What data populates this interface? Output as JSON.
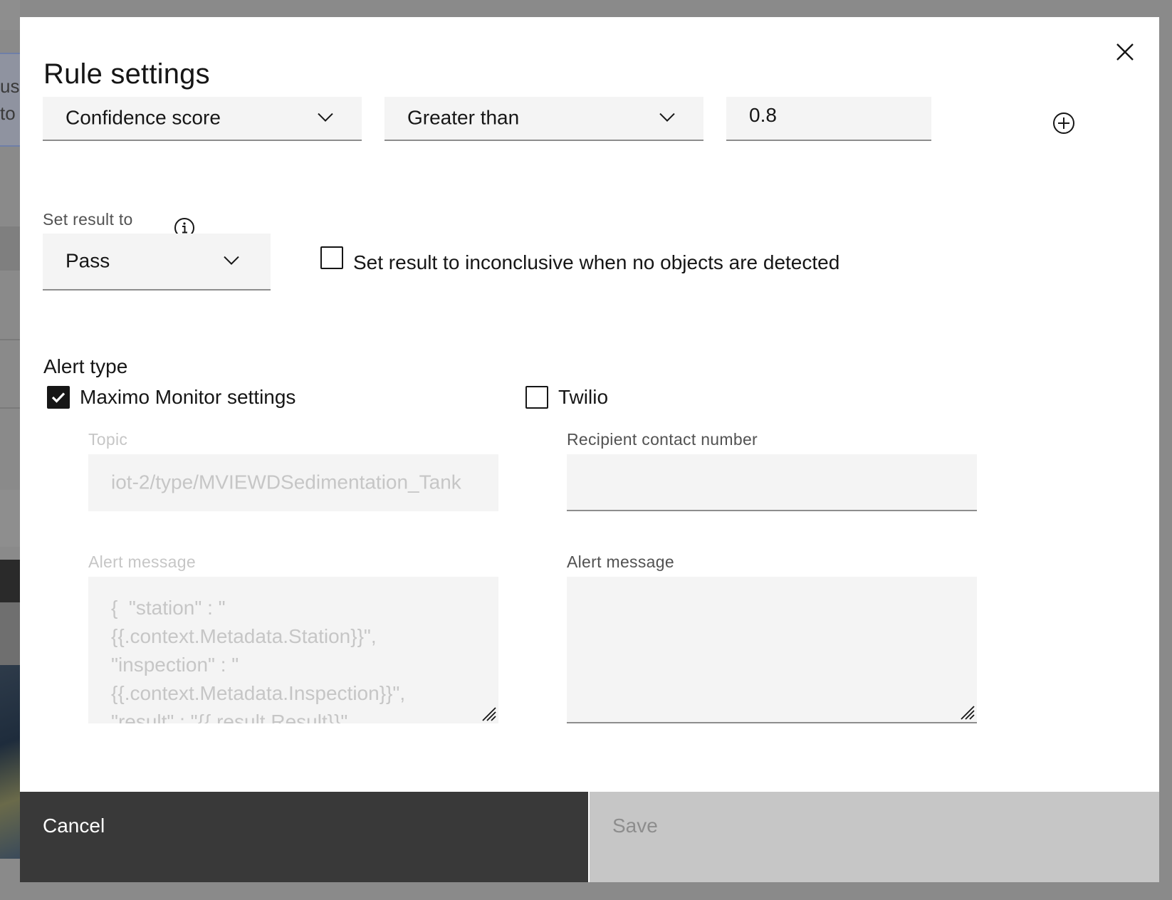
{
  "modal": {
    "title": "Rule settings"
  },
  "condition": {
    "property": "Confidence score",
    "operator": "Greater than",
    "value": "0.8"
  },
  "result": {
    "label": "Set result to",
    "selected": "Pass",
    "inconclusive_checkbox_label": "Set result to inconclusive when no objects are detected",
    "inconclusive_checked": false
  },
  "alert_type": {
    "title": "Alert type",
    "maximo": {
      "label": "Maximo Monitor settings",
      "checked": true,
      "topic_label": "Topic",
      "topic_value": "iot-2/type/MVIEWDSedimentation_Tank",
      "message_label": "Alert message",
      "message_value": "{  \"station\" : \"{{.context.Metadata.Station}}\", \"inspection\" : \"{{.context.Metadata.Inspection}}\", \"result\" : \"{{.result.Result}}\""
    },
    "twilio": {
      "label": "Twilio",
      "checked": false,
      "recipient_label": "Recipient contact number",
      "recipient_value": "",
      "message_label": "Alert message",
      "message_value": ""
    }
  },
  "footer": {
    "cancel_label": "Cancel",
    "save_label": "Save"
  },
  "background": {
    "partial_text_1": "us",
    "partial_text_2": "to"
  }
}
